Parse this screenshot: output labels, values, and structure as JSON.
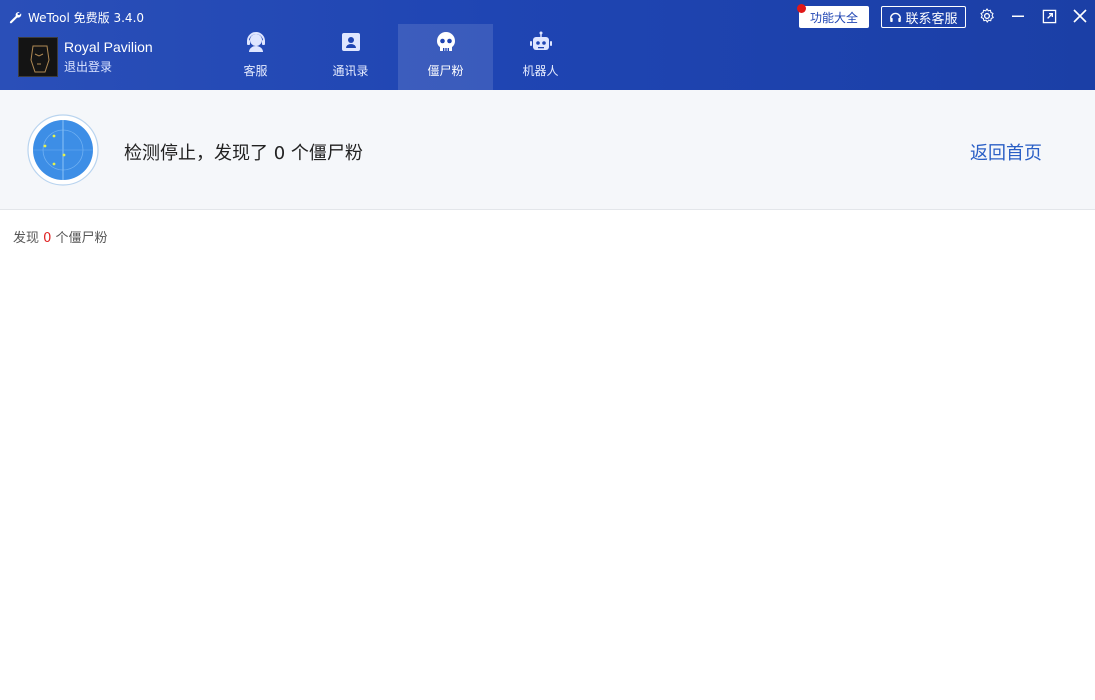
{
  "app": {
    "title": "WeTool 免费版 3.4.0",
    "icon": "wrench-icon"
  },
  "user": {
    "name": "Royal Pavilion",
    "logout_label": "退出登录"
  },
  "nav": {
    "items": [
      {
        "label": "客服",
        "icon": "customer-service-icon",
        "active": false
      },
      {
        "label": "通讯录",
        "icon": "contacts-icon",
        "active": false
      },
      {
        "label": "僵尸粉",
        "icon": "skull-icon",
        "active": true
      },
      {
        "label": "机器人",
        "icon": "robot-icon",
        "active": false
      }
    ]
  },
  "toolbar": {
    "features_label": "功能大全",
    "contact_label": "联系客服"
  },
  "status": {
    "message": "检测停止，发现了 0 个僵尸粉",
    "back_label": "返回首页"
  },
  "result": {
    "prefix": "发现 ",
    "count": "0",
    "suffix": " 个僵尸粉"
  },
  "colors": {
    "header": "#1f45b3",
    "accent": "#2a5fc6",
    "count": "#e02424"
  }
}
